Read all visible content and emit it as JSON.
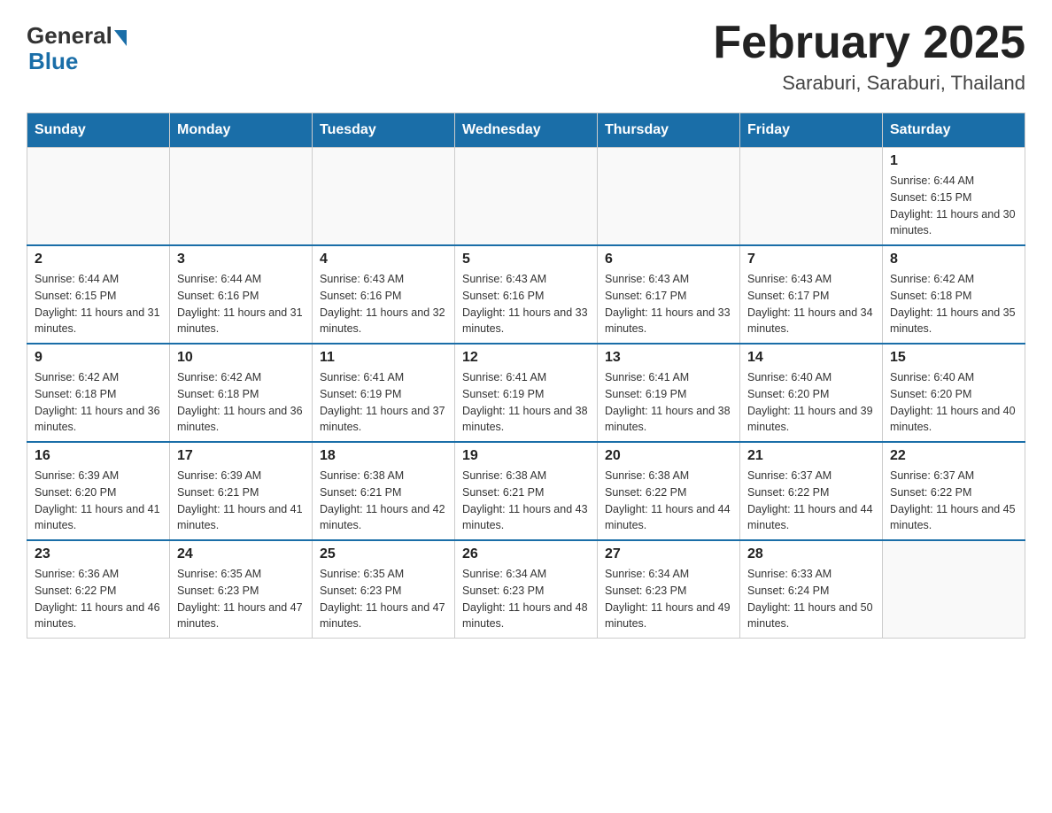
{
  "header": {
    "logo_general": "General",
    "logo_blue": "Blue",
    "month_title": "February 2025",
    "location": "Saraburi, Saraburi, Thailand"
  },
  "weekdays": [
    "Sunday",
    "Monday",
    "Tuesday",
    "Wednesday",
    "Thursday",
    "Friday",
    "Saturday"
  ],
  "weeks": [
    [
      {
        "day": "",
        "sunrise": "",
        "sunset": "",
        "daylight": ""
      },
      {
        "day": "",
        "sunrise": "",
        "sunset": "",
        "daylight": ""
      },
      {
        "day": "",
        "sunrise": "",
        "sunset": "",
        "daylight": ""
      },
      {
        "day": "",
        "sunrise": "",
        "sunset": "",
        "daylight": ""
      },
      {
        "day": "",
        "sunrise": "",
        "sunset": "",
        "daylight": ""
      },
      {
        "day": "",
        "sunrise": "",
        "sunset": "",
        "daylight": ""
      },
      {
        "day": "1",
        "sunrise": "Sunrise: 6:44 AM",
        "sunset": "Sunset: 6:15 PM",
        "daylight": "Daylight: 11 hours and 30 minutes."
      }
    ],
    [
      {
        "day": "2",
        "sunrise": "Sunrise: 6:44 AM",
        "sunset": "Sunset: 6:15 PM",
        "daylight": "Daylight: 11 hours and 31 minutes."
      },
      {
        "day": "3",
        "sunrise": "Sunrise: 6:44 AM",
        "sunset": "Sunset: 6:16 PM",
        "daylight": "Daylight: 11 hours and 31 minutes."
      },
      {
        "day": "4",
        "sunrise": "Sunrise: 6:43 AM",
        "sunset": "Sunset: 6:16 PM",
        "daylight": "Daylight: 11 hours and 32 minutes."
      },
      {
        "day": "5",
        "sunrise": "Sunrise: 6:43 AM",
        "sunset": "Sunset: 6:16 PM",
        "daylight": "Daylight: 11 hours and 33 minutes."
      },
      {
        "day": "6",
        "sunrise": "Sunrise: 6:43 AM",
        "sunset": "Sunset: 6:17 PM",
        "daylight": "Daylight: 11 hours and 33 minutes."
      },
      {
        "day": "7",
        "sunrise": "Sunrise: 6:43 AM",
        "sunset": "Sunset: 6:17 PM",
        "daylight": "Daylight: 11 hours and 34 minutes."
      },
      {
        "day": "8",
        "sunrise": "Sunrise: 6:42 AM",
        "sunset": "Sunset: 6:18 PM",
        "daylight": "Daylight: 11 hours and 35 minutes."
      }
    ],
    [
      {
        "day": "9",
        "sunrise": "Sunrise: 6:42 AM",
        "sunset": "Sunset: 6:18 PM",
        "daylight": "Daylight: 11 hours and 36 minutes."
      },
      {
        "day": "10",
        "sunrise": "Sunrise: 6:42 AM",
        "sunset": "Sunset: 6:18 PM",
        "daylight": "Daylight: 11 hours and 36 minutes."
      },
      {
        "day": "11",
        "sunrise": "Sunrise: 6:41 AM",
        "sunset": "Sunset: 6:19 PM",
        "daylight": "Daylight: 11 hours and 37 minutes."
      },
      {
        "day": "12",
        "sunrise": "Sunrise: 6:41 AM",
        "sunset": "Sunset: 6:19 PM",
        "daylight": "Daylight: 11 hours and 38 minutes."
      },
      {
        "day": "13",
        "sunrise": "Sunrise: 6:41 AM",
        "sunset": "Sunset: 6:19 PM",
        "daylight": "Daylight: 11 hours and 38 minutes."
      },
      {
        "day": "14",
        "sunrise": "Sunrise: 6:40 AM",
        "sunset": "Sunset: 6:20 PM",
        "daylight": "Daylight: 11 hours and 39 minutes."
      },
      {
        "day": "15",
        "sunrise": "Sunrise: 6:40 AM",
        "sunset": "Sunset: 6:20 PM",
        "daylight": "Daylight: 11 hours and 40 minutes."
      }
    ],
    [
      {
        "day": "16",
        "sunrise": "Sunrise: 6:39 AM",
        "sunset": "Sunset: 6:20 PM",
        "daylight": "Daylight: 11 hours and 41 minutes."
      },
      {
        "day": "17",
        "sunrise": "Sunrise: 6:39 AM",
        "sunset": "Sunset: 6:21 PM",
        "daylight": "Daylight: 11 hours and 41 minutes."
      },
      {
        "day": "18",
        "sunrise": "Sunrise: 6:38 AM",
        "sunset": "Sunset: 6:21 PM",
        "daylight": "Daylight: 11 hours and 42 minutes."
      },
      {
        "day": "19",
        "sunrise": "Sunrise: 6:38 AM",
        "sunset": "Sunset: 6:21 PM",
        "daylight": "Daylight: 11 hours and 43 minutes."
      },
      {
        "day": "20",
        "sunrise": "Sunrise: 6:38 AM",
        "sunset": "Sunset: 6:22 PM",
        "daylight": "Daylight: 11 hours and 44 minutes."
      },
      {
        "day": "21",
        "sunrise": "Sunrise: 6:37 AM",
        "sunset": "Sunset: 6:22 PM",
        "daylight": "Daylight: 11 hours and 44 minutes."
      },
      {
        "day": "22",
        "sunrise": "Sunrise: 6:37 AM",
        "sunset": "Sunset: 6:22 PM",
        "daylight": "Daylight: 11 hours and 45 minutes."
      }
    ],
    [
      {
        "day": "23",
        "sunrise": "Sunrise: 6:36 AM",
        "sunset": "Sunset: 6:22 PM",
        "daylight": "Daylight: 11 hours and 46 minutes."
      },
      {
        "day": "24",
        "sunrise": "Sunrise: 6:35 AM",
        "sunset": "Sunset: 6:23 PM",
        "daylight": "Daylight: 11 hours and 47 minutes."
      },
      {
        "day": "25",
        "sunrise": "Sunrise: 6:35 AM",
        "sunset": "Sunset: 6:23 PM",
        "daylight": "Daylight: 11 hours and 47 minutes."
      },
      {
        "day": "26",
        "sunrise": "Sunrise: 6:34 AM",
        "sunset": "Sunset: 6:23 PM",
        "daylight": "Daylight: 11 hours and 48 minutes."
      },
      {
        "day": "27",
        "sunrise": "Sunrise: 6:34 AM",
        "sunset": "Sunset: 6:23 PM",
        "daylight": "Daylight: 11 hours and 49 minutes."
      },
      {
        "day": "28",
        "sunrise": "Sunrise: 6:33 AM",
        "sunset": "Sunset: 6:24 PM",
        "daylight": "Daylight: 11 hours and 50 minutes."
      },
      {
        "day": "",
        "sunrise": "",
        "sunset": "",
        "daylight": ""
      }
    ]
  ]
}
